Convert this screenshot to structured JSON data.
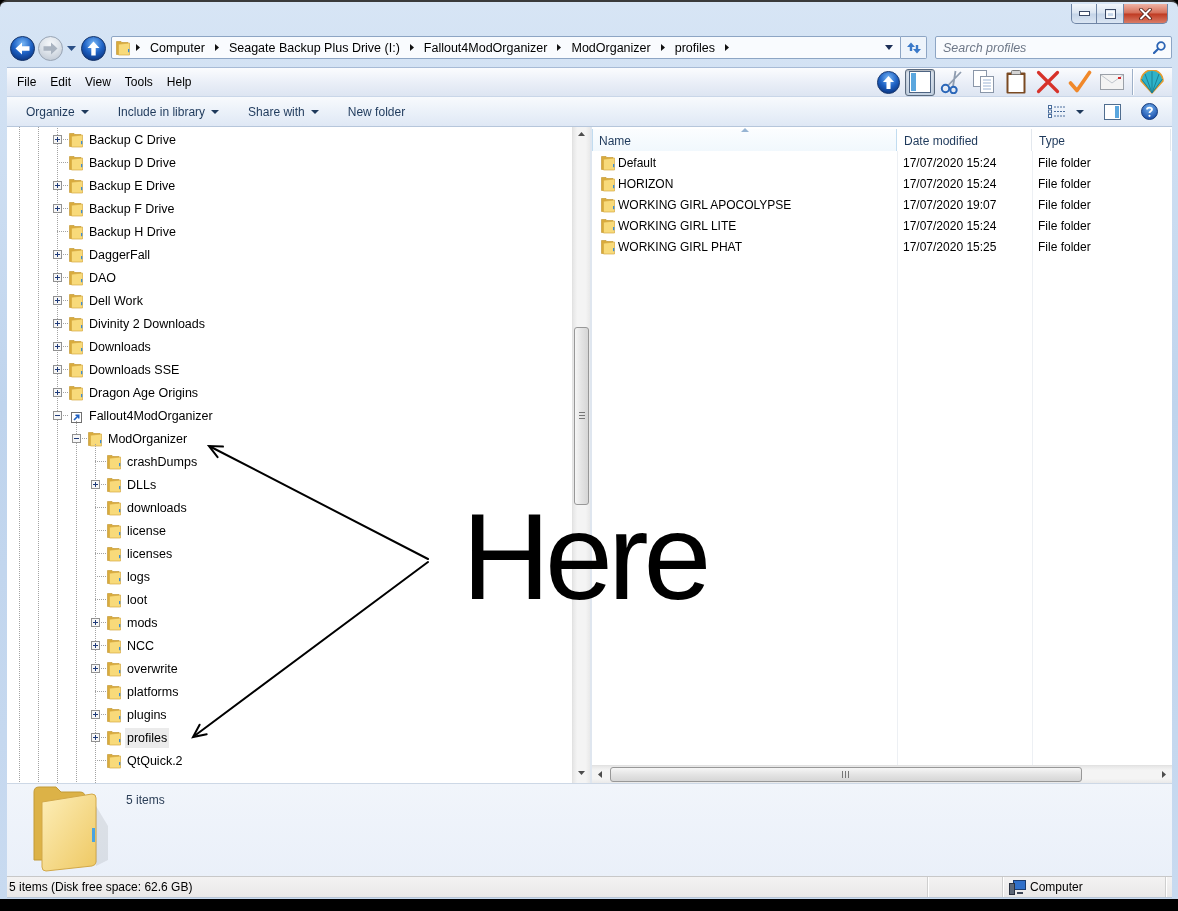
{
  "navigation": [
    {
      "kind": "back",
      "disabled": false
    },
    {
      "kind": "forward",
      "disabled": true
    },
    {
      "kind": "history"
    },
    {
      "kind": "up",
      "disabled": false
    }
  ],
  "address_bar": {
    "path": [
      "Computer",
      "Seagate Backup Plus Drive (I:)",
      "Fallout4ModOrganizer",
      "ModOrganizer",
      "profiles"
    ]
  },
  "search": {
    "placeholder": "Search profiles"
  },
  "menu": [
    "File",
    "Edit",
    "View",
    "Tools",
    "Help"
  ],
  "toolbar": [
    {
      "kind": "up",
      "on": false
    },
    {
      "kind": "panel",
      "on": true
    },
    {
      "kind": "cut",
      "on": false
    },
    {
      "kind": "copy",
      "on": false
    },
    {
      "kind": "paste",
      "on": false
    },
    {
      "kind": "delete",
      "on": false
    },
    {
      "kind": "check",
      "on": false
    },
    {
      "kind": "mail",
      "on": false
    },
    {
      "kind": "separator"
    },
    {
      "kind": "shell",
      "on": false
    }
  ],
  "commands": [
    {
      "label": "Organize",
      "dropdown": true
    },
    {
      "label": "Include in library",
      "dropdown": true
    },
    {
      "label": "Share with",
      "dropdown": true
    },
    {
      "label": "New folder",
      "dropdown": false
    }
  ],
  "navigation_tree": [
    {
      "label": "Backup C Drive",
      "kind": "folder",
      "expanded": false,
      "selected": false
    },
    {
      "label": "Backup D Drive",
      "kind": "folder",
      "selected": false
    },
    {
      "label": "Backup E Drive",
      "kind": "folder",
      "expanded": false,
      "selected": false
    },
    {
      "label": "Backup F Drive",
      "kind": "folder",
      "expanded": false,
      "selected": false
    },
    {
      "label": "Backup H Drive",
      "kind": "folder",
      "selected": false
    },
    {
      "label": "DaggerFall",
      "kind": "folder",
      "expanded": false,
      "selected": false
    },
    {
      "label": "DAO",
      "kind": "folder",
      "expanded": false,
      "selected": false
    },
    {
      "label": "Dell Work",
      "kind": "folder",
      "expanded": false,
      "selected": false
    },
    {
      "label": "Divinity 2 Downloads",
      "kind": "folder",
      "expanded": false,
      "selected": false
    },
    {
      "label": "Downloads",
      "kind": "folder",
      "expanded": false,
      "selected": false
    },
    {
      "label": "Downloads SSE",
      "kind": "folder",
      "expanded": false,
      "selected": false
    },
    {
      "label": "Dragon Age Origins",
      "kind": "folder",
      "expanded": false,
      "selected": false
    },
    {
      "label": "Fallout4ModOrganizer",
      "kind": "link",
      "expanded": true,
      "selected": false,
      "children": [
        {
          "label": "ModOrganizer",
          "kind": "folder",
          "expanded": true,
          "selected": false,
          "children": [
            {
              "label": "crashDumps",
              "kind": "folder",
              "selected": false
            },
            {
              "label": "DLLs",
              "kind": "folder",
              "expanded": false,
              "selected": false
            },
            {
              "label": "downloads",
              "kind": "folder",
              "selected": false
            },
            {
              "label": "license",
              "kind": "folder",
              "selected": false
            },
            {
              "label": "licenses",
              "kind": "folder",
              "selected": false
            },
            {
              "label": "logs",
              "kind": "folder",
              "selected": false
            },
            {
              "label": "loot",
              "kind": "folder",
              "selected": false
            },
            {
              "label": "mods",
              "kind": "folder",
              "expanded": false,
              "selected": false
            },
            {
              "label": "NCC",
              "kind": "folder",
              "expanded": false,
              "selected": false
            },
            {
              "label": "overwrite",
              "kind": "folder",
              "expanded": false,
              "selected": false
            },
            {
              "label": "platforms",
              "kind": "folder",
              "selected": false
            },
            {
              "label": "plugins",
              "kind": "folder",
              "expanded": false,
              "selected": false
            },
            {
              "label": "profiles",
              "kind": "folder",
              "expanded": false,
              "selected": true
            },
            {
              "label": "QtQuick.2",
              "kind": "folder",
              "selected": false
            }
          ]
        }
      ]
    }
  ],
  "file_list": {
    "columns": [
      {
        "label": "Name",
        "sorted": true
      },
      {
        "label": "Date modified",
        "sorted": false
      },
      {
        "label": "Type",
        "sorted": false
      }
    ],
    "rows": [
      {
        "name": "Default",
        "date_modified": "17/07/2020 15:24",
        "type": "File folder"
      },
      {
        "name": "HORIZON",
        "date_modified": "17/07/2020 15:24",
        "type": "File folder"
      },
      {
        "name": "WORKING GIRL APOCOLYPSE",
        "date_modified": "17/07/2020 19:07",
        "type": "File folder"
      },
      {
        "name": "WORKING GIRL LITE",
        "date_modified": "17/07/2020 15:24",
        "type": "File folder"
      },
      {
        "name": "WORKING GIRL PHAT",
        "date_modified": "17/07/2020 15:25",
        "type": "File folder"
      }
    ]
  },
  "details_pane": {
    "summary": "5 items"
  },
  "status_bar": {
    "text": "5 items (Disk free space: 62.6 GB)",
    "location": "Computer"
  },
  "annotation": {
    "text": "Here"
  }
}
